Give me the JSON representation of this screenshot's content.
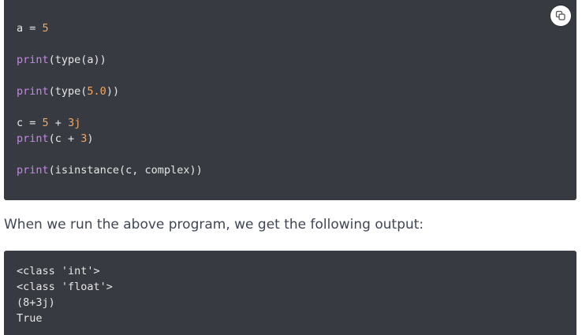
{
  "code_block": {
    "copy_button_icon": "copy-icon",
    "lines": [
      {
        "tokens": [
          {
            "t": "a",
            "k": "var"
          },
          {
            "t": " = ",
            "k": "op"
          },
          {
            "t": "5",
            "k": "num"
          }
        ]
      },
      {
        "tokens": []
      },
      {
        "tokens": [
          {
            "t": "print",
            "k": "fn"
          },
          {
            "t": "(type(a))",
            "k": "var"
          }
        ]
      },
      {
        "tokens": []
      },
      {
        "tokens": [
          {
            "t": "print",
            "k": "fn"
          },
          {
            "t": "(type(",
            "k": "var"
          },
          {
            "t": "5.0",
            "k": "num"
          },
          {
            "t": "))",
            "k": "var"
          }
        ]
      },
      {
        "tokens": []
      },
      {
        "tokens": [
          {
            "t": "c",
            "k": "var"
          },
          {
            "t": " = ",
            "k": "op"
          },
          {
            "t": "5",
            "k": "num"
          },
          {
            "t": " + ",
            "k": "op"
          },
          {
            "t": "3j",
            "k": "num"
          }
        ]
      },
      {
        "tokens": [
          {
            "t": "print",
            "k": "fn"
          },
          {
            "t": "(c + ",
            "k": "var"
          },
          {
            "t": "3",
            "k": "num"
          },
          {
            "t": ")",
            "k": "var"
          }
        ]
      },
      {
        "tokens": []
      },
      {
        "tokens": [
          {
            "t": "print",
            "k": "fn"
          },
          {
            "t": "(isinstance(c, complex))",
            "k": "var"
          }
        ]
      }
    ]
  },
  "description": "When we run the above program, we get the following output:",
  "output_block": {
    "lines": [
      "<class 'int'>",
      "<class 'float'>",
      "(8+3j)",
      "True"
    ]
  },
  "colors": {
    "code_background": "#373a40",
    "function": "#c586e8",
    "number": "#f0a868",
    "text": "#e6e6e6",
    "description_text": "#3f4552"
  }
}
